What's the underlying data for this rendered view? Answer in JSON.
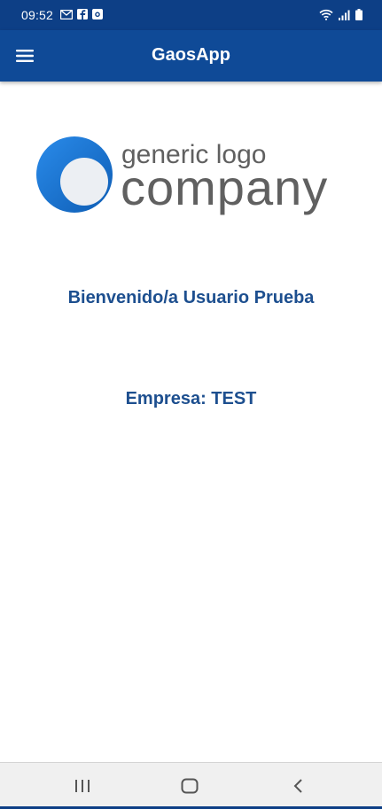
{
  "status_bar": {
    "time": "09:52",
    "left_icons": [
      "gmail-icon",
      "facebook-icon",
      "camera-icon"
    ],
    "right_icons": [
      "wifi-icon",
      "signal-icon",
      "battery-icon"
    ]
  },
  "app_bar": {
    "title": "GaosApp",
    "menu_icon": "hamburger-menu-icon"
  },
  "logo": {
    "line1": "generic logo",
    "line2": "company"
  },
  "main": {
    "welcome": "Bienvenido/a Usuario Prueba",
    "company": "Empresa: TEST"
  },
  "nav_bar": {
    "items": [
      "recent-apps-icon",
      "home-icon",
      "back-icon"
    ]
  },
  "colors": {
    "status_bar": "#0d3f86",
    "app_bar": "#0f4a97",
    "text_accent": "#1d4f8f",
    "logo_text": "#606060",
    "logo_blue": "#1a73d1",
    "nav_bg": "#f0f0f0"
  }
}
